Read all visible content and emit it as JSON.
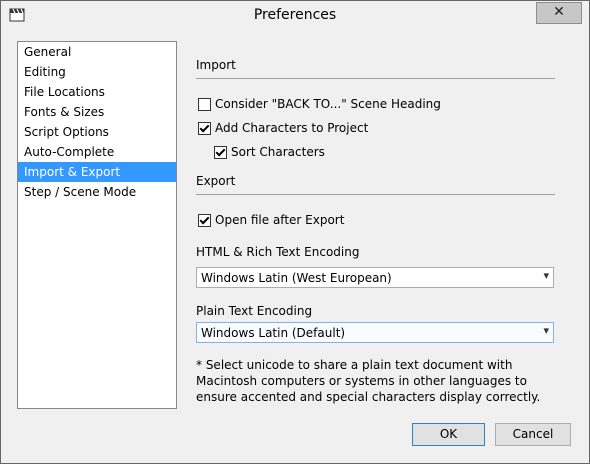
{
  "window": {
    "title": "Preferences",
    "close_glyph": "✕",
    "app_icon": "clapperboard-icon"
  },
  "categories": [
    {
      "label": "General",
      "selected": false
    },
    {
      "label": "Editing",
      "selected": false
    },
    {
      "label": "File Locations",
      "selected": false
    },
    {
      "label": "Fonts & Sizes",
      "selected": false
    },
    {
      "label": "Script Options",
      "selected": false
    },
    {
      "label": "Auto-Complete",
      "selected": false
    },
    {
      "label": "Import & Export",
      "selected": true
    },
    {
      "label": "Step / Scene Mode",
      "selected": false
    }
  ],
  "import": {
    "heading": "Import",
    "consider_back_to": {
      "label": "Consider \"BACK TO...\"  Scene Heading",
      "checked": false
    },
    "add_characters": {
      "label": "Add Characters to Project",
      "checked": true
    },
    "sort_characters": {
      "label": "Sort Characters",
      "checked": true
    }
  },
  "export": {
    "heading": "Export",
    "open_after_export": {
      "label": "Open file after Export",
      "checked": true
    },
    "html_encoding_label": "HTML & Rich Text Encoding",
    "html_encoding_value": "Windows Latin (West European)",
    "plain_encoding_label": "Plain Text Encoding",
    "plain_encoding_value": "Windows Latin (Default)",
    "note": "* Select unicode to share a plain text document with Macintosh computers or systems in other languages to ensure accented and special characters display correctly."
  },
  "buttons": {
    "ok": "OK",
    "cancel": "Cancel"
  },
  "colors": {
    "selection": "#3399ff",
    "window_bg": "#f0f0f0"
  }
}
